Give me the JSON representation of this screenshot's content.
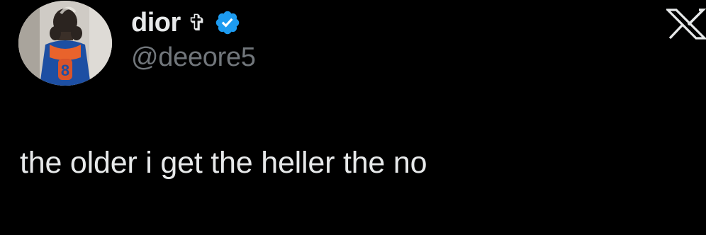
{
  "tweet": {
    "author": {
      "display_name": "dior",
      "name_emoji": "✞",
      "verified": true,
      "handle": "@deeore5",
      "avatar": "profile-photo"
    },
    "text": "the older i get the heller the no",
    "platform_logo": "x-logo"
  },
  "colors": {
    "background": "#000000",
    "primary_text": "#e7e9ea",
    "secondary_text": "#71767b",
    "verified_blue": "#1d9bf0"
  }
}
